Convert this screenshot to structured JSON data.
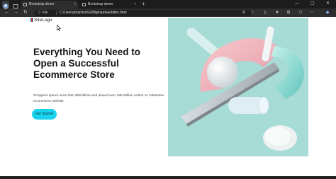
{
  "browser": {
    "tabs": [
      {
        "title": "Bootstrap demo",
        "active": true
      },
      {
        "title": "Bootstrap demo",
        "active": false
      }
    ],
    "new_tab_glyph": "+",
    "close_glyph": "×",
    "window_controls": [
      "—",
      "▢",
      "✕"
    ],
    "address": {
      "info_label": "File",
      "url": "C:/Users/practice%20figma/one/index.html"
    },
    "colors": {
      "profile_accent": "#8ab4f8"
    }
  },
  "page": {
    "logo_text": "SiteLogo",
    "headline": "Everything You Need to Open a Successful Ecommerce Store",
    "lead": "Shoppers spend more than $26 billion and placed over 185 Million orders on SiteName ecommerce website",
    "cta_label": "Get Started",
    "colors": {
      "cta": "#19d3ee",
      "hero_bg": "#a7dbd6"
    }
  }
}
